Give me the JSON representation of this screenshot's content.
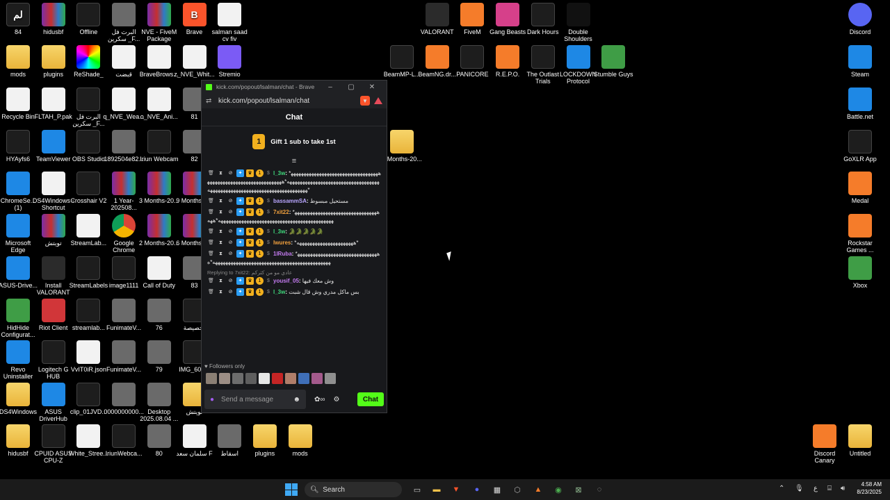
{
  "desktop": {
    "icons": [
      {
        "label": "84",
        "x": 0,
        "y": 5,
        "kind": "dark",
        "glyph": "لم"
      },
      {
        "label": "hidusbf",
        "x": 1,
        "y": 5,
        "kind": "rar",
        "glyph": ""
      },
      {
        "label": "Offline",
        "x": 2,
        "y": 5,
        "kind": "dark",
        "glyph": ""
      },
      {
        "label": "البرت فل سكرين _F...",
        "x": 3,
        "y": 5,
        "kind": "img",
        "glyph": ""
      },
      {
        "label": "NVE - FiveM Package",
        "x": 4,
        "y": 5,
        "kind": "rar",
        "glyph": ""
      },
      {
        "label": "Brave",
        "x": 5,
        "y": 5,
        "kind": "brave",
        "glyph": "B"
      },
      {
        "label": "salman saad cv fiv",
        "x": 6,
        "y": 5,
        "kind": "file",
        "glyph": ""
      },
      {
        "label": "mods",
        "x": 0,
        "y": 1,
        "kind": "folder"
      },
      {
        "label": "plugins",
        "x": 1,
        "y": 1,
        "kind": "folder"
      },
      {
        "label": "ReShade_",
        "x": 2,
        "y": 1,
        "kind": "reshade"
      },
      {
        "label": "قبضت",
        "x": 3,
        "y": 1,
        "kind": "file"
      },
      {
        "label": "BraveBrows...",
        "x": 4,
        "y": 1,
        "kind": "file"
      },
      {
        "label": "z_NVE_Whit...",
        "x": 5,
        "y": 1,
        "kind": "file"
      },
      {
        "label": "Stremio",
        "x": 6,
        "y": 1,
        "kind": "stremio"
      },
      {
        "label": "Recycle Bin",
        "x": 0,
        "y": 2,
        "kind": "file"
      },
      {
        "label": "FLTAH_P.pak",
        "x": 1,
        "y": 2,
        "kind": "file"
      },
      {
        "label": "البرت فل سكرين _F...",
        "x": 2,
        "y": 2,
        "kind": "dark"
      },
      {
        "label": "q_NVE_Wea...",
        "x": 3,
        "y": 2,
        "kind": "file"
      },
      {
        "label": "o_NVE_Ani...",
        "x": 4,
        "y": 2,
        "kind": "file"
      },
      {
        "label": "81",
        "x": 5,
        "y": 2,
        "kind": "img"
      },
      {
        "label": "HYAyfs6",
        "x": 0,
        "y": 3,
        "kind": "dark"
      },
      {
        "label": "TeamViewer",
        "x": 1,
        "y": 3,
        "kind": "blue"
      },
      {
        "label": "OBS Studio",
        "x": 2,
        "y": 3,
        "kind": "dark"
      },
      {
        "label": "1892504e82...",
        "x": 3,
        "y": 3,
        "kind": "img"
      },
      {
        "label": "Iriun Webcam",
        "x": 4,
        "y": 3,
        "kind": "dark"
      },
      {
        "label": "82",
        "x": 5,
        "y": 3,
        "kind": "img"
      },
      {
        "label": "ChromeSe... (1)",
        "x": 0,
        "y": 4,
        "kind": "blue"
      },
      {
        "label": "DS4Windows - Shortcut",
        "x": 1,
        "y": 4,
        "kind": "file"
      },
      {
        "label": "Crosshair V2",
        "x": 2,
        "y": 4,
        "kind": "dark"
      },
      {
        "label": "1 Year-202508...",
        "x": 3,
        "y": 4,
        "kind": "rar"
      },
      {
        "label": "3 Months-20...",
        "x": 4,
        "y": 4,
        "kind": "rar"
      },
      {
        "label": "9 Months-2...",
        "x": 5,
        "y": 4,
        "kind": "rar"
      },
      {
        "label": "Microsoft Edge",
        "x": 0,
        "y": 6,
        "kind": "blue"
      },
      {
        "label": "تويتش",
        "x": 1,
        "y": 6,
        "kind": "rar"
      },
      {
        "label": "StreamLab...",
        "x": 2,
        "y": 6,
        "kind": "file"
      },
      {
        "label": "Google Chrome",
        "x": 3,
        "y": 6,
        "kind": "chrome"
      },
      {
        "label": "2 Months-20...",
        "x": 4,
        "y": 6,
        "kind": "rar"
      },
      {
        "label": "6 Months-2...",
        "x": 5,
        "y": 6,
        "kind": "rar"
      },
      {
        "label": "ASUS-Drive...",
        "x": 0,
        "y": 7,
        "kind": "blue"
      },
      {
        "label": "Install VALORANT",
        "x": 1,
        "y": 7,
        "kind": "val"
      },
      {
        "label": "StreamLabels",
        "x": 2,
        "y": 7,
        "kind": "dark"
      },
      {
        "label": "image1111",
        "x": 3,
        "y": 7,
        "kind": "dark"
      },
      {
        "label": "Call of Duty",
        "x": 4,
        "y": 7,
        "kind": "file"
      },
      {
        "label": "83",
        "x": 5,
        "y": 7,
        "kind": "img"
      },
      {
        "label": "HidHide Configurat...",
        "x": 0,
        "y": 8,
        "kind": "green"
      },
      {
        "label": "Riot Client",
        "x": 1,
        "y": 8,
        "kind": "riot"
      },
      {
        "label": "streamlab...",
        "x": 2,
        "y": 8,
        "kind": "dark"
      },
      {
        "label": "FunimateV...",
        "x": 3,
        "y": 8,
        "kind": "img"
      },
      {
        "label": "76",
        "x": 4,
        "y": 8,
        "kind": "img"
      },
      {
        "label": "تخصيصة",
        "x": 5,
        "y": 8,
        "kind": "dark"
      },
      {
        "label": "Revo Uninstaller",
        "x": 0,
        "y": 9,
        "kind": "blue"
      },
      {
        "label": "Logitech G HUB",
        "x": 1,
        "y": 9,
        "kind": "dark"
      },
      {
        "label": "VvIT0iR.json",
        "x": 2,
        "y": 9,
        "kind": "file"
      },
      {
        "label": "FunimateV...",
        "x": 3,
        "y": 9,
        "kind": "img"
      },
      {
        "label": "79",
        "x": 4,
        "y": 9,
        "kind": "img"
      },
      {
        "label": "IMG_600...",
        "x": 5,
        "y": 9,
        "kind": "dark"
      },
      {
        "label": "DS4Windows",
        "x": 0,
        "y": 10,
        "kind": "folder"
      },
      {
        "label": "ASUS DriverHub",
        "x": 1,
        "y": 10,
        "kind": "blue"
      },
      {
        "label": "clip_01JVD...",
        "x": 2,
        "y": 10,
        "kind": "dark"
      },
      {
        "label": "0000000000...",
        "x": 3,
        "y": 10,
        "kind": "img"
      },
      {
        "label": "Desktop 2025.08.04 ...",
        "x": 4,
        "y": 10,
        "kind": "img"
      },
      {
        "label": "تويتش",
        "x": 5,
        "y": 10,
        "kind": "folder"
      },
      {
        "label": "hidusbf",
        "x": 0,
        "y": 11,
        "kind": "folder"
      },
      {
        "label": "CPUID ASUS CPU-Z",
        "x": 1,
        "y": 11,
        "kind": "dark"
      },
      {
        "label": "White_Stree...",
        "x": 2,
        "y": 11,
        "kind": "file"
      },
      {
        "label": "IriunWebca...",
        "x": 3,
        "y": 11,
        "kind": "dark"
      },
      {
        "label": "80",
        "x": 4,
        "y": 11,
        "kind": "img"
      },
      {
        "label": "سلمان سعد F",
        "x": 5,
        "y": 11,
        "kind": "file"
      },
      {
        "label": "اسقاط",
        "x": 6,
        "y": 11,
        "kind": "img"
      },
      {
        "label": "plugins",
        "x": 7,
        "y": 11,
        "kind": "folder"
      },
      {
        "label": "mods",
        "x": 8,
        "y": 11,
        "kind": "folder"
      },
      {
        "label": "VALORANT",
        "x": 10,
        "y": 5,
        "kind": "val"
      },
      {
        "label": "FiveM",
        "x": 11,
        "y": 5,
        "kind": "orange"
      },
      {
        "label": "Gang Beasts",
        "x": 12,
        "y": 5,
        "kind": "pink"
      },
      {
        "label": "Dark Hours",
        "x": 13,
        "y": 5,
        "kind": "dark"
      },
      {
        "label": "Double Shoulders",
        "x": 14,
        "y": 5,
        "kind": "ds"
      },
      {
        "label": "BeamMP-L...",
        "x": 9,
        "y": 1,
        "kind": "dark"
      },
      {
        "label": "BeamNG.dr...",
        "x": 10,
        "y": 1,
        "kind": "orange"
      },
      {
        "label": "PANICORE",
        "x": 11,
        "y": 1,
        "kind": "dark"
      },
      {
        "label": "R.E.P.O.",
        "x": 12,
        "y": 1,
        "kind": "orange"
      },
      {
        "label": "The Outlast Trials",
        "x": 13,
        "y": 1,
        "kind": "dark"
      },
      {
        "label": "LOCKDOWN Protocol",
        "x": 14,
        "y": 1,
        "kind": "blue"
      },
      {
        "label": "Stumble Guys",
        "x": 15,
        "y": 1,
        "kind": "green"
      },
      {
        "label": "9 Months-20...",
        "x": 9,
        "y": 3,
        "kind": "folder"
      },
      {
        "label": "Discord",
        "x": 20,
        "y": 5,
        "kind": "discord"
      },
      {
        "label": "Steam",
        "x": 20,
        "y": 1,
        "kind": "blue"
      },
      {
        "label": "Battle.net",
        "x": 20,
        "y": 2,
        "kind": "blue"
      },
      {
        "label": "GoXLR App",
        "x": 20,
        "y": 3,
        "kind": "dark"
      },
      {
        "label": "Medal",
        "x": 20,
        "y": 4,
        "kind": "orange"
      },
      {
        "label": "Rockstar Games ...",
        "x": 20,
        "y": 6,
        "kind": "orange"
      },
      {
        "label": "Xbox",
        "x": 20,
        "y": 7,
        "kind": "green"
      },
      {
        "label": "Discord Canary",
        "x": 19,
        "y": 11,
        "kind": "orange"
      },
      {
        "label": "Untitled",
        "x": 20,
        "y": 11,
        "kind": "folder"
      }
    ]
  },
  "window": {
    "title": "kick.com/popout/lsalman/chat - Brave",
    "url": "kick.com/popout/lsalman/chat"
  },
  "chat": {
    "header": "Chat",
    "gift_text": "Gift 1 sub to take 1st",
    "gift_coin": "1",
    "messages": [
      {
        "user": "l_3w",
        "color": "#3fd97c",
        "text": "*ههههههههههههههههههههههههههههههههههههههههههههههههههههههههههههههههههههههه*ههههههههههههههههههههههههههههههههههههههههههههههههههههههههههههههههههههه*",
        "reply": ""
      },
      {
        "user": "bassammSA",
        "color": "#b9a6ff",
        "text": "مستحيل مبسوط",
        "reply": ""
      },
      {
        "user": "7xit22",
        "color": "#f2a13d",
        "text": "*هههههههههههههههههههههههههههههههههههههههههههههههههههههههههههههههههههههههههههههه*ههه",
        "reply": ""
      },
      {
        "user": "l_3w",
        "color": "#3fd97c",
        "text": "🐊🐊🐊🐊🐊",
        "reply": ""
      },
      {
        "user": "lwures",
        "color": "#f2a13d",
        "text": "*ههههههههههههههههههههههه*",
        "reply": ""
      },
      {
        "user": "1lRuba",
        "color": "#c57cf2",
        "text": "*هههههههههههههههههههههههههههههههههههههههههههههههههههههههههههههههههههههههههههههه*ه",
        "reply": ""
      },
      {
        "user": "yousif_05",
        "color": "#c57cf2",
        "text": "وش معك فيها",
        "reply": "Replying to 7xit22: عادي مو من كثركم"
      },
      {
        "user": "l_3w",
        "color": "#3fd97c",
        "text": "بس ماكل مدري وش قال شبت",
        "reply": ""
      }
    ],
    "followers_only": "Followers only",
    "input_placeholder": "Send a message",
    "send_label": "Chat"
  },
  "taskbar": {
    "search_label": "Search",
    "lang": "ع",
    "time": "4:58 AM",
    "date": "8/23/2025"
  }
}
